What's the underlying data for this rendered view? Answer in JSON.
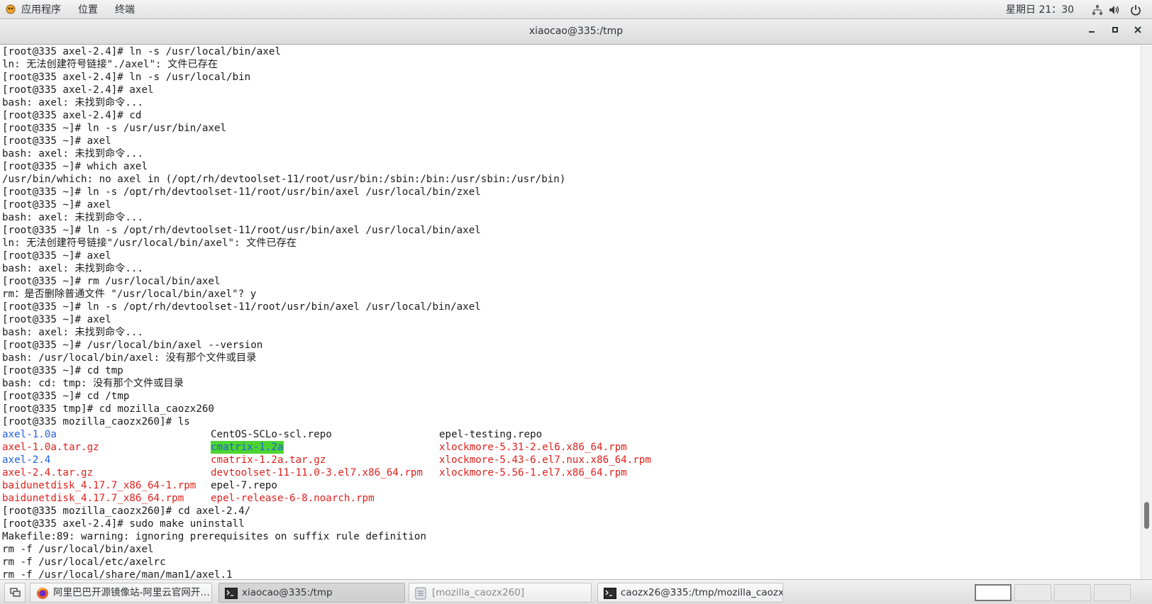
{
  "top_panel": {
    "menus": [
      "应用程序",
      "位置",
      "终端"
    ],
    "clock": "星期日 21：30",
    "tray_icons": [
      "network-icon",
      "volume-icon",
      "power-icon"
    ]
  },
  "window": {
    "title": "xiaocao@335:/tmp",
    "buttons": [
      "minimize",
      "maximize",
      "close"
    ]
  },
  "terminal": {
    "lines_before": [
      "[root@335 axel-2.4]# ln -s /usr/local/bin/axel",
      "ln: 无法创建符号链接\"./axel\": 文件已存在",
      "[root@335 axel-2.4]# ln -s /usr/local/bin",
      "[root@335 axel-2.4]# axel",
      "bash: axel: 未找到命令...",
      "[root@335 axel-2.4]# cd",
      "[root@335 ~]# ln -s /usr/usr/bin/axel",
      "[root@335 ~]# axel",
      "bash: axel: 未找到命令...",
      "[root@335 ~]# which axel",
      "/usr/bin/which: no axel in (/opt/rh/devtoolset-11/root/usr/bin:/sbin:/bin:/usr/sbin:/usr/bin)",
      "[root@335 ~]# ln -s /opt/rh/devtoolset-11/root/usr/bin/axel /usr/local/bin/zxel",
      "[root@335 ~]# axel",
      "bash: axel: 未找到命令...",
      "[root@335 ~]# ln -s /opt/rh/devtoolset-11/root/usr/bin/axel /usr/local/bin/axel",
      "ln: 无法创建符号链接\"/usr/local/bin/axel\": 文件已存在",
      "[root@335 ~]# axel",
      "bash: axel: 未找到命令...",
      "[root@335 ~]# rm /usr/local/bin/axel",
      "rm：是否删除普通文件 \"/usr/local/bin/axel\"? y",
      "[root@335 ~]# ln -s /opt/rh/devtoolset-11/root/usr/bin/axel /usr/local/bin/axel",
      "[root@335 ~]# axel",
      "bash: axel: 未找到命令...",
      "[root@335 ~]# /usr/local/bin/axel --version",
      "bash: /usr/local/bin/axel: 没有那个文件或目录",
      "[root@335 ~]# cd tmp",
      "bash: cd: tmp: 没有那个文件或目录",
      "[root@335 ~]# cd /tmp",
      "[root@335 tmp]# cd mozilla_caozx260",
      "[root@335 mozilla_caozx260]# ls"
    ],
    "ls_columns": [
      [
        {
          "text": "axel-1.0a",
          "color": "blue"
        },
        {
          "text": "axel-1.0a.tar.gz",
          "color": "red"
        },
        {
          "text": "axel-2.4",
          "color": "blue"
        },
        {
          "text": "axel-2.4.tar.gz",
          "color": "red"
        },
        {
          "text": "baidunetdisk_4.17.7_x86_64-1.rpm",
          "color": "red"
        },
        {
          "text": "baidunetdisk_4.17.7_x86_64.rpm",
          "color": "red"
        }
      ],
      [
        {
          "text": "CentOS-SCLo-scl.repo",
          "color": "plain"
        },
        {
          "text": "cmatrix-1.2a",
          "color": "highlight"
        },
        {
          "text": "cmatrix-1.2a.tar.gz",
          "color": "red"
        },
        {
          "text": "devtoolset-11-11.0-3.el7.x86_64.rpm",
          "color": "red"
        },
        {
          "text": "epel-7.repo",
          "color": "plain"
        },
        {
          "text": "epel-release-6-8.noarch.rpm",
          "color": "red"
        }
      ],
      [
        {
          "text": "epel-testing.repo",
          "color": "plain"
        },
        {
          "text": "xlockmore-5.31-2.el6.x86_64.rpm",
          "color": "red"
        },
        {
          "text": "xlockmore-5.43-6.el7.nux.x86_64.rpm",
          "color": "red"
        },
        {
          "text": "xlockmore-5.56-1.el7.x86_64.rpm",
          "color": "red"
        }
      ]
    ],
    "lines_after": [
      "[root@335 mozilla_caozx260]# cd axel-2.4/",
      "[root@335 axel-2.4]# sudo make uninstall",
      "Makefile:89: warning: ignoring prerequisites on suffix rule definition",
      "rm -f /usr/local/bin/axel",
      "rm -f /usr/local/etc/axelrc",
      "rm -f /usr/local/share/man/man1/axel.1"
    ],
    "scroll_position": 0.9
  },
  "taskbar": {
    "tasks": [
      {
        "label": "阿里巴巴开源镜像站-阿里云官网开…",
        "icon": "firefox-icon",
        "state": "normal"
      },
      {
        "label": "xiaocao@335:/tmp",
        "icon": "terminal-icon",
        "state": "active"
      },
      {
        "label": "[mozilla_caozx260]",
        "icon": "file-manager-icon",
        "state": "dim"
      },
      {
        "label": "caozx26@335:/tmp/mozilla_caozx…",
        "icon": "terminal-icon",
        "state": "normal"
      }
    ],
    "workspaces": 4,
    "active_workspace": 1
  }
}
